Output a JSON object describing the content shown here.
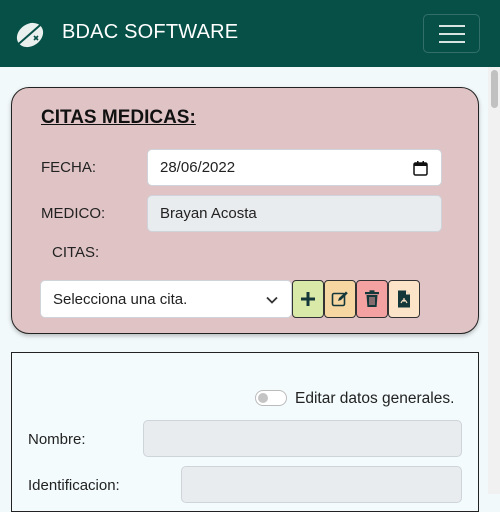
{
  "navbar": {
    "brand": "BDAC SOFTWARE",
    "logo_icon": "leaf-logo-icon",
    "menu_icon": "hamburger-menu-icon"
  },
  "citas_card": {
    "title": "CITAS MEDICAS:",
    "fecha_label": "FECHA:",
    "fecha_value": "28/06/2022",
    "medico_label": "MEDICO:",
    "medico_value": "Brayan Acosta",
    "citas_label": "CITAS:",
    "citas_select_value": "Selecciona una cita.",
    "buttons": [
      {
        "name": "add-cita-button",
        "icon": "plus-icon",
        "bg": "#d8e9a8"
      },
      {
        "name": "edit-cita-button",
        "icon": "edit-icon",
        "bg": "#f6d7a2"
      },
      {
        "name": "delete-cita-button",
        "icon": "trash-icon",
        "bg": "#f3a1a1"
      },
      {
        "name": "pdf-cita-button",
        "icon": "file-pdf-icon",
        "bg": "#fce4c8"
      }
    ],
    "bg": "#e0c3c5"
  },
  "form_card": {
    "toggle_label": "Editar datos generales.",
    "nombre_label": "Nombre:",
    "nombre_value": "",
    "identificacion_label": "Identificacion:",
    "identificacion_value": ""
  },
  "colors": {
    "navbar": "#075048",
    "page_bg": "#f2f9fb"
  }
}
